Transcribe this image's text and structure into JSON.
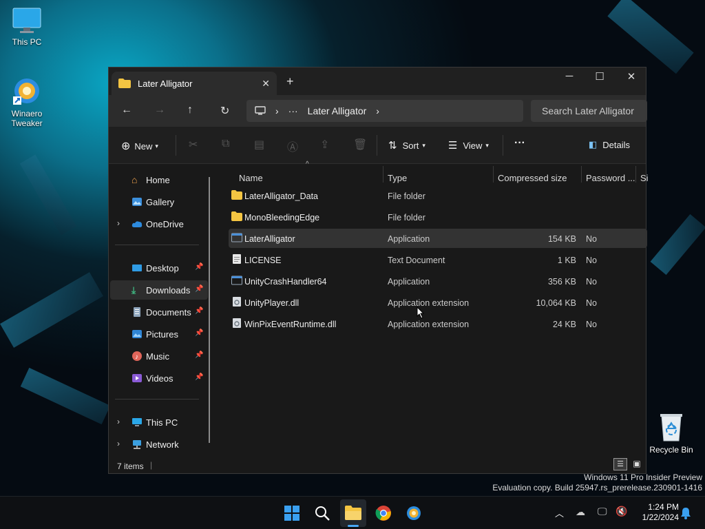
{
  "desktop": {
    "icons": [
      {
        "label": "This PC"
      },
      {
        "label": "Winaero Tweaker"
      },
      {
        "label": "Recycle Bin"
      }
    ],
    "watermark_line1": "Windows 11 Pro Insider Preview",
    "watermark_line2": "Evaluation copy. Build 25947.rs_prerelease.230901-1416"
  },
  "window": {
    "tab_title": "Later Alligator",
    "address": {
      "more": "···",
      "folder": "Later Alligator"
    },
    "search_placeholder": "Search Later Alligator",
    "commandbar": {
      "new_label": "New",
      "sort_label": "Sort",
      "view_label": "View",
      "more_label": "···",
      "details_label": "Details"
    },
    "sidebar": {
      "items": [
        {
          "label": "Home"
        },
        {
          "label": "Gallery"
        },
        {
          "label": "OneDrive"
        },
        {
          "label": "Desktop"
        },
        {
          "label": "Downloads"
        },
        {
          "label": "Documents"
        },
        {
          "label": "Pictures"
        },
        {
          "label": "Music"
        },
        {
          "label": "Videos"
        },
        {
          "label": "This PC"
        },
        {
          "label": "Network"
        }
      ],
      "active": "Downloads"
    },
    "columns": {
      "name": "Name",
      "type": "Type",
      "compressed_size": "Compressed size",
      "password": "Password ...",
      "size": "Si"
    },
    "files": [
      {
        "name": "LaterAlligator_Data",
        "type": "File folder",
        "size": "",
        "password": "",
        "kind": "folder"
      },
      {
        "name": "MonoBleedingEdge",
        "type": "File folder",
        "size": "",
        "password": "",
        "kind": "folder"
      },
      {
        "name": "LaterAlligator",
        "type": "Application",
        "size": "154 KB",
        "password": "No",
        "kind": "app"
      },
      {
        "name": "LICENSE",
        "type": "Text Document",
        "size": "1 KB",
        "password": "No",
        "kind": "doc"
      },
      {
        "name": "UnityCrashHandler64",
        "type": "Application",
        "size": "356 KB",
        "password": "No",
        "kind": "app"
      },
      {
        "name": "UnityPlayer.dll",
        "type": "Application extension",
        "size": "10,064 KB",
        "password": "No",
        "kind": "dll"
      },
      {
        "name": "WinPixEventRuntime.dll",
        "type": "Application extension",
        "size": "24 KB",
        "password": "No",
        "kind": "dll"
      }
    ],
    "status": {
      "count": "7 items"
    }
  },
  "taskbar": {
    "time": "1:24 PM",
    "date": "1/22/2024"
  }
}
